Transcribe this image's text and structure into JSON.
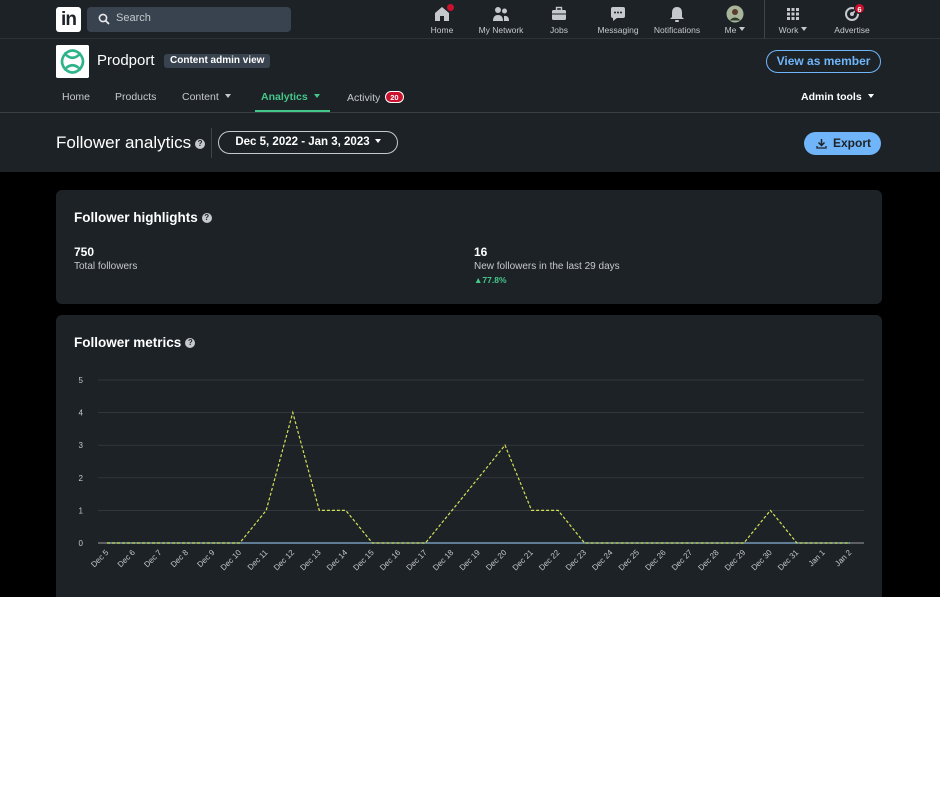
{
  "global_nav": {
    "search_placeholder": "Search",
    "items": [
      {
        "label": "Home",
        "icon": "home-icon"
      },
      {
        "label": "My Network",
        "icon": "network-icon"
      },
      {
        "label": "Jobs",
        "icon": "briefcase-icon"
      },
      {
        "label": "Messaging",
        "icon": "message-icon"
      },
      {
        "label": "Notifications",
        "icon": "bell-icon"
      },
      {
        "label": "Me",
        "icon": "avatar"
      },
      {
        "label": "Work",
        "icon": "grid-icon"
      },
      {
        "label": "Advertise",
        "icon": "advertise-icon"
      }
    ],
    "advertise_badge": "6"
  },
  "org": {
    "name": "Prodport",
    "admin_pill": "Content admin view",
    "view_as_member": "View as member"
  },
  "subnav": {
    "items": [
      "Home",
      "Products",
      "Content",
      "Analytics",
      "Activity"
    ],
    "active": "Analytics",
    "activity_badge": "20",
    "admin_tools": "Admin tools"
  },
  "page": {
    "title": "Follower analytics",
    "date_range": "Dec 5, 2022 - Jan 3, 2023",
    "export_label": "Export"
  },
  "highlights": {
    "title": "Follower highlights",
    "total_value": "750",
    "total_label": "Total followers",
    "new_value": "16",
    "new_label": "New followers in the last 29 days",
    "new_change": "77.8%"
  },
  "metrics": {
    "title": "Follower metrics"
  },
  "colors": {
    "accent_green": "#44c78a",
    "link_blue": "#70b5f9",
    "badge_red": "#cb112d",
    "series_line": "#d4e157",
    "baseline_line": "#8ab4d8"
  },
  "chart_data": {
    "type": "line",
    "y_ticks": [
      0,
      1,
      2,
      3,
      4,
      5
    ],
    "ylim": [
      0,
      5
    ],
    "categories": [
      "Dec 5",
      "Dec 6",
      "Dec 7",
      "Dec 8",
      "Dec 9",
      "Dec 10",
      "Dec 11",
      "Dec 12",
      "Dec 13",
      "Dec 14",
      "Dec 15",
      "Dec 16",
      "Dec 17",
      "Dec 18",
      "Dec 19",
      "Dec 20",
      "Dec 21",
      "Dec 22",
      "Dec 23",
      "Dec 24",
      "Dec 25",
      "Dec 26",
      "Dec 27",
      "Dec 28",
      "Dec 29",
      "Dec 30",
      "Dec 31",
      "Jan 1",
      "Jan 2"
    ],
    "series": [
      {
        "values": [
          0,
          0,
          0,
          0,
          0,
          0,
          1,
          4,
          1,
          1,
          0,
          0,
          0,
          1,
          2,
          3,
          1,
          1,
          0,
          0,
          0,
          0,
          0,
          0,
          0,
          1,
          0,
          0,
          0
        ],
        "style": "dashed"
      },
      {
        "values": [
          0,
          0,
          0,
          0,
          0,
          0,
          0,
          0,
          0,
          0,
          0,
          0,
          0,
          0,
          0,
          0,
          0,
          0,
          0,
          0,
          0,
          0,
          0,
          0,
          0,
          0,
          0,
          0,
          0
        ],
        "style": "solid"
      }
    ],
    "grid": true
  }
}
